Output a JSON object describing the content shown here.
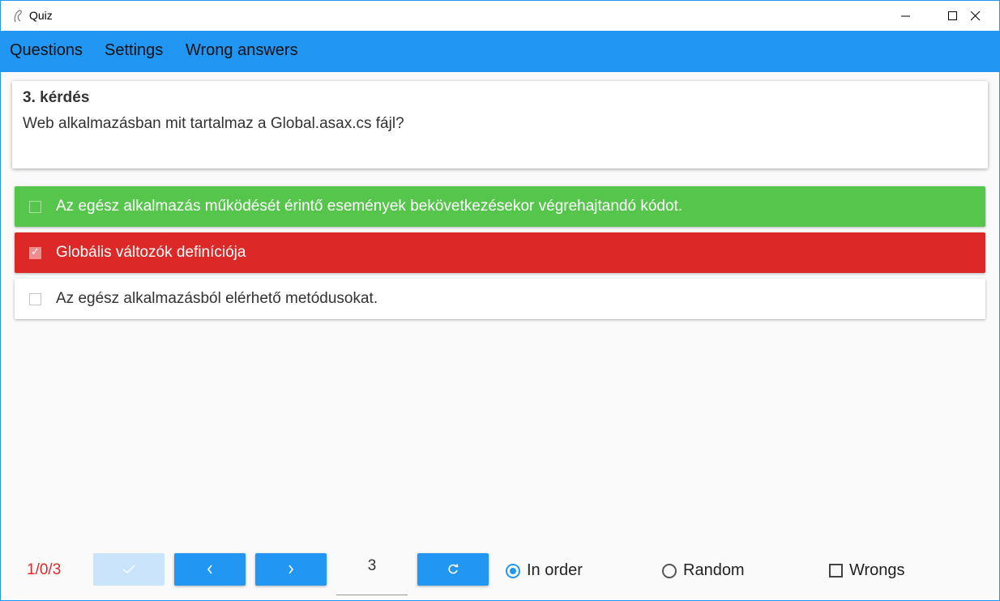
{
  "window": {
    "title": "Quiz",
    "icon": "quiz-app-icon",
    "controls": [
      "minimize-icon",
      "maximize-icon",
      "close-icon"
    ]
  },
  "menu": {
    "items": [
      {
        "label": "Questions"
      },
      {
        "label": "Settings"
      },
      {
        "label": "Wrong answers"
      }
    ]
  },
  "question": {
    "number": "3. kérdés",
    "text": "Web alkalmazásban mit tartalmaz a Global.asax.cs fájl?"
  },
  "answers": [
    {
      "text": "Az egész alkalmazás működését érintő események bekövetkezésekor végrehajtandó kódot.",
      "state": "correct",
      "checked": false,
      "color": "#55c64b"
    },
    {
      "text": "Globális változók definíciója",
      "state": "wrong",
      "checked": true,
      "color": "#dd2828"
    },
    {
      "text": "Az egész alkalmazásból elérhető metódusokat.",
      "state": "neutral",
      "checked": false,
      "color": "#ffffff"
    }
  ],
  "footer": {
    "score": "1/0/3",
    "check_button_icon": "check-icon",
    "prev_button_icon": "chevron-left-icon",
    "next_button_icon": "chevron-right-icon",
    "question_input_value": "3",
    "reload_button_icon": "reload-icon",
    "order_options": [
      {
        "label": "In order",
        "selected": true
      },
      {
        "label": "Random",
        "selected": false
      }
    ],
    "wrongs_label": "Wrongs",
    "wrongs_checked": false
  },
  "colors": {
    "accent": "#2196f3",
    "correct": "#55c64b",
    "wrong": "#dd2828",
    "score_text": "#dd2828"
  }
}
